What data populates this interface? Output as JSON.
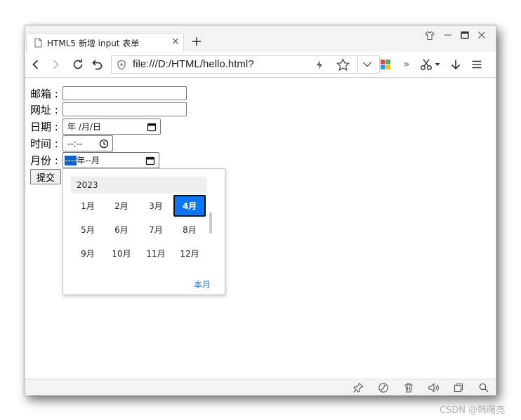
{
  "browser": {
    "tab_title": "HTML5 新增 input 表单",
    "tab_close": "×",
    "new_tab": "+",
    "address": "file:///D:/HTML/hello.html?",
    "icons": [
      "page-icon",
      "close-icon",
      "plus-icon",
      "shirt-icon",
      "minimize-icon",
      "maximize-icon",
      "window-close-icon",
      "back-icon",
      "forward-icon",
      "reload-icon",
      "undo-icon",
      "shield-icon",
      "lightning-icon",
      "star-icon",
      "chevron-down-icon",
      "apps-icon",
      "more-icon",
      "scissors-icon",
      "download-icon",
      "menu-icon"
    ]
  },
  "form": {
    "email_label": "邮箱 :",
    "url_label": "网址 :",
    "date_label": "日期 :",
    "date_value": "年 /月/日",
    "time_label": "时间 :",
    "time_value": "--:--",
    "month_label": "月份 :",
    "month_year_sel": "----",
    "month_value": "年--月",
    "submit_label": "提交"
  },
  "picker": {
    "year": "2023",
    "months": [
      "1月",
      "2月",
      "3月",
      "4月",
      "5月",
      "6月",
      "7月",
      "8月",
      "9月",
      "10月",
      "11月",
      "12月"
    ],
    "selected_index": 3,
    "this_month": "本月"
  },
  "status_icons": [
    "pin-icon",
    "feed-icon",
    "trash-icon",
    "speaker-icon",
    "window-icon",
    "search-icon"
  ],
  "watermark": "CSDN @韩曙亮"
}
